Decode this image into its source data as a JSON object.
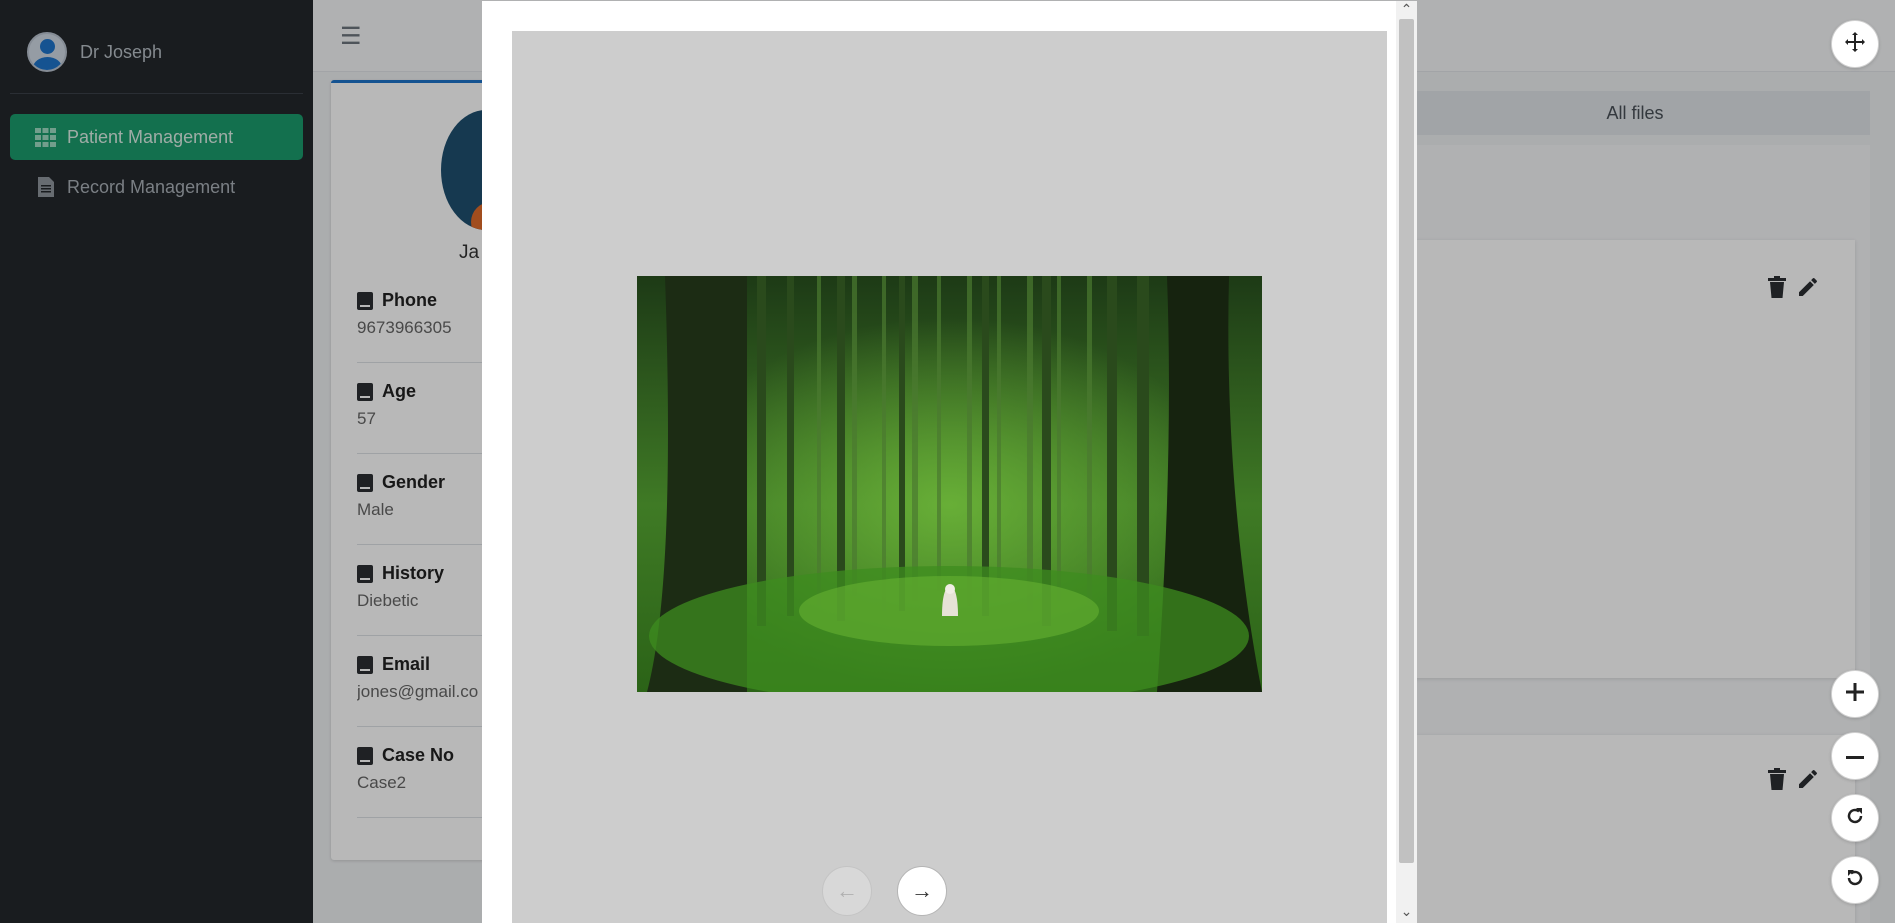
{
  "sidebar": {
    "username": "Dr Joseph",
    "items": [
      {
        "label": "Patient Management",
        "icon": "grid-icon",
        "active": true
      },
      {
        "label": "Record Management",
        "icon": "document-icon",
        "active": false
      }
    ]
  },
  "header": {
    "menu_icon": "hamburger-icon"
  },
  "patient": {
    "name": "Ja",
    "fields": [
      {
        "label": "Phone",
        "value": "9673966305"
      },
      {
        "label": "Age",
        "value": "57"
      },
      {
        "label": "Gender",
        "value": "Male"
      },
      {
        "label": "History",
        "value": "Diebetic"
      },
      {
        "label": "Email",
        "value": "jones@gmail.co"
      },
      {
        "label": "Case No",
        "value": "Case2"
      }
    ]
  },
  "files": {
    "tab_label": "All files"
  },
  "viewer": {
    "prev_icon": "arrow-left-icon",
    "next_icon": "arrow-right-icon",
    "image_subject": "forest"
  },
  "toolbar": {
    "move_icon": "move-icon",
    "zoom_in_icon": "plus-icon",
    "zoom_out_icon": "minus-icon",
    "rotate_cw_icon": "rotate-clockwise-icon",
    "rotate_ccw_icon": "rotate-counterclockwise-icon"
  },
  "colors": {
    "sidebar_bg": "#23272b",
    "active_nav": "#1b9b6c",
    "accent": "#1e73c9",
    "viewer_bg": "#cdcdcd"
  }
}
